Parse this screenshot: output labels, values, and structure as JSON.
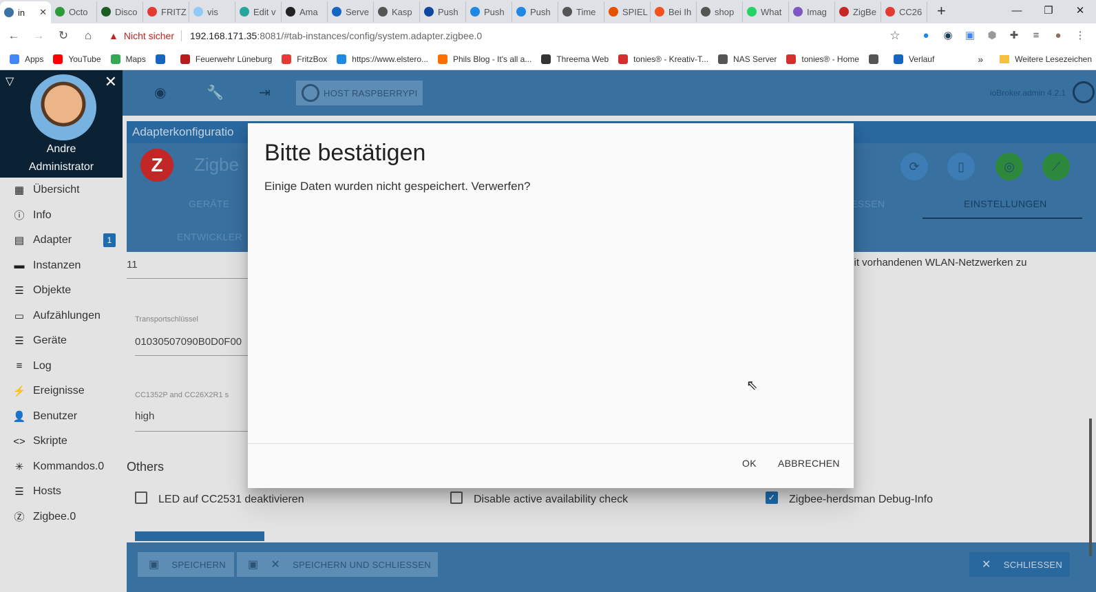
{
  "browser": {
    "tabs": [
      {
        "label": "in",
        "color": "#3a73a4",
        "active": true
      },
      {
        "label": "Octo",
        "color": "#2e9b3a"
      },
      {
        "label": "Disco",
        "color": "#1b5e20"
      },
      {
        "label": "FRITZ",
        "color": "#e53935"
      },
      {
        "label": "vis",
        "color": "#90caf9"
      },
      {
        "label": "Edit v",
        "color": "#26a69a"
      },
      {
        "label": "Ama",
        "color": "#222"
      },
      {
        "label": "Serve",
        "color": "#1565c0"
      },
      {
        "label": "Kasp",
        "color": "#555"
      },
      {
        "label": "Push",
        "color": "#0d47a1"
      },
      {
        "label": "Push",
        "color": "#1e88e5"
      },
      {
        "label": "Push",
        "color": "#1e88e5"
      },
      {
        "label": "Time",
        "color": "#555"
      },
      {
        "label": "SPIEL",
        "color": "#e65100"
      },
      {
        "label": "Bei Ih",
        "color": "#f4511e"
      },
      {
        "label": "shop",
        "color": "#555"
      },
      {
        "label": "What",
        "color": "#25d366"
      },
      {
        "label": "Imag",
        "color": "#7e57c2"
      },
      {
        "label": "ZigBe",
        "color": "#c62828"
      },
      {
        "label": "CC26",
        "color": "#e53935"
      }
    ],
    "close_glyph": "✕",
    "new_tab": "+",
    "window_controls": [
      "—",
      "❐",
      "✕"
    ],
    "security_warning": "Nicht sicher",
    "url_host": "192.168.171.35",
    "url_path": ":8081/#tab-instances/config/system.adapter.zigbee.0",
    "bookmarks": [
      {
        "label": "Apps",
        "color": "#4285f4"
      },
      {
        "label": "YouTube",
        "color": "#ff0000"
      },
      {
        "label": "Maps",
        "color": "#34a853"
      },
      {
        "label": "",
        "color": "#1565c0"
      },
      {
        "label": "Feuerwehr Lüneburg",
        "color": "#b71c1c"
      },
      {
        "label": "FritzBox",
        "color": "#e53935"
      },
      {
        "label": "https://www.elstero...",
        "color": "#1e88e5"
      },
      {
        "label": "Phils Blog - It's all a...",
        "color": "#ff6f00"
      },
      {
        "label": "Threema Web",
        "color": "#333"
      },
      {
        "label": "tonies® - Kreativ-T...",
        "color": "#d32f2f"
      },
      {
        "label": "NAS Server",
        "color": "#555"
      },
      {
        "label": "tonies® - Home",
        "color": "#d32f2f"
      },
      {
        "label": "",
        "color": "#555"
      },
      {
        "label": "Verlauf",
        "color": "#1565c0"
      }
    ],
    "more_bookmarks": "»",
    "other_bookmarks": "Weitere Lesezeichen"
  },
  "app": {
    "user": {
      "first": "Andre",
      "role": "Administrator"
    },
    "menu": [
      {
        "label": "Übersicht",
        "icon": "grid-icon",
        "glyph": "▦"
      },
      {
        "label": "Info",
        "icon": "info-icon",
        "glyph": "ⓘ"
      },
      {
        "label": "Adapter",
        "icon": "store-icon",
        "glyph": "▤",
        "badge": "1"
      },
      {
        "label": "Instanzen",
        "icon": "instances-icon",
        "glyph": "▬"
      },
      {
        "label": "Objekte",
        "icon": "list-icon",
        "glyph": "☰"
      },
      {
        "label": "Aufzählungen",
        "icon": "enum-icon",
        "glyph": "▭"
      },
      {
        "label": "Geräte",
        "icon": "devices-icon",
        "glyph": "☰"
      },
      {
        "label": "Log",
        "icon": "log-icon",
        "glyph": "≡"
      },
      {
        "label": "Ereignisse",
        "icon": "flash-icon",
        "glyph": "⚡"
      },
      {
        "label": "Benutzer",
        "icon": "user-icon",
        "glyph": "👤"
      },
      {
        "label": "Skripte",
        "icon": "code-icon",
        "glyph": "<>"
      },
      {
        "label": "Kommandos.0",
        "icon": "asterisk-icon",
        "glyph": "✳"
      },
      {
        "label": "Hosts",
        "icon": "hosts-icon",
        "glyph": "☰"
      },
      {
        "label": "Zigbee.0",
        "icon": "zigbee-icon",
        "glyph": "Ⓩ"
      }
    ],
    "host_button": "HOST RASPBERRYPI",
    "version": "ioBroker.admin 4.2.1",
    "config_header": "Adapterkonfiguratio",
    "adapter_title": "Zigbe",
    "adapter_logo": "Z",
    "tabs": {
      "geraete": "GERÄTE",
      "entwickler": "ENTWICKLER",
      "schliessen": "LIESSEN",
      "einstellungen": "EINSTELLUNGEN"
    },
    "fields": {
      "channel_value": "11",
      "wlan_hint": "mit vorhandenen WLAN-Netzwerken zu",
      "transport_label": "Transportschlüssel",
      "transport_value": "01030507090B0D0F00",
      "power_label": "CC1352P and CC26X2R1 s",
      "power_value": "high"
    },
    "others_title": "Others",
    "checkboxes": [
      {
        "label": "LED auf CC2531 deaktivieren",
        "checked": false
      },
      {
        "label": "Disable active availability check",
        "checked": false
      },
      {
        "label": "Zigbee-herdsman Debug-Info",
        "checked": true
      }
    ],
    "footer": {
      "save": "SPEICHERN",
      "save_close": "SPEICHERN UND SCHLIESSEN",
      "close": "SCHLIESSEN"
    }
  },
  "dialog": {
    "title": "Bitte bestätigen",
    "message": "Einige Daten wurden nicht gespeichert. Verwerfen?",
    "ok": "OK",
    "cancel": "ABBRECHEN"
  }
}
